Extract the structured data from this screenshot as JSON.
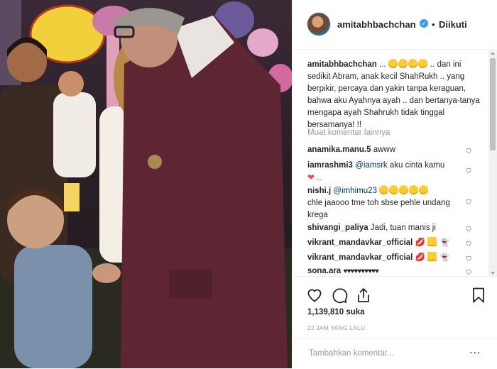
{
  "header": {
    "username": "amitabhbachchan",
    "separator": "•",
    "follow_label": "Diikuti"
  },
  "caption": {
    "username": "amitabhbachchan",
    "text_lead": "...",
    "text": ".. dan ini sedikit Abram, anak kecil ShahRukh .. yang berpikir, percaya dan yakin tanpa keraguan, bahwa aku Ayahnya ayah .. dan bertanya-tanya mengapa ayah Shahrukh tidak tinggal bersamanya! !!"
  },
  "load_more": "Muat komentar lainnya",
  "comments": [
    {
      "username": "anamika.manu.5",
      "text": "awww"
    },
    {
      "username": "iamrashmi3",
      "mention": "@iamsrk",
      "text": "aku cinta kamu",
      "text2": ".."
    },
    {
      "username": "nishi.j",
      "mention": "@imhimu23",
      "text": "chle jaaooo tme toh sbse pehle undang krega"
    },
    {
      "username": "shivangi_paliya",
      "text": "Jadi, tuan manis ji"
    },
    {
      "username": "vikrant_mandavkar_official",
      "text": ""
    },
    {
      "username": "vikrant_mandavkar_official",
      "text": ""
    },
    {
      "username": "sona.ara",
      "text": "♥♥♥♥♥♥♥♥♥♥"
    }
  ],
  "likes": "1,139,810 suka",
  "timestamp": "22 JAM YANG LALU",
  "add_comment": {
    "placeholder": "Tambahkan komentar..."
  },
  "more_options": "...",
  "icons": [
    "heart-icon",
    "comment-icon",
    "share-icon",
    "bookmark-icon",
    "verified-icon",
    "more-options-icon"
  ],
  "colors": {
    "verified": "#3897f0",
    "mention": "#003569",
    "red_heart": "#ed4956",
    "muted": "#999999"
  }
}
